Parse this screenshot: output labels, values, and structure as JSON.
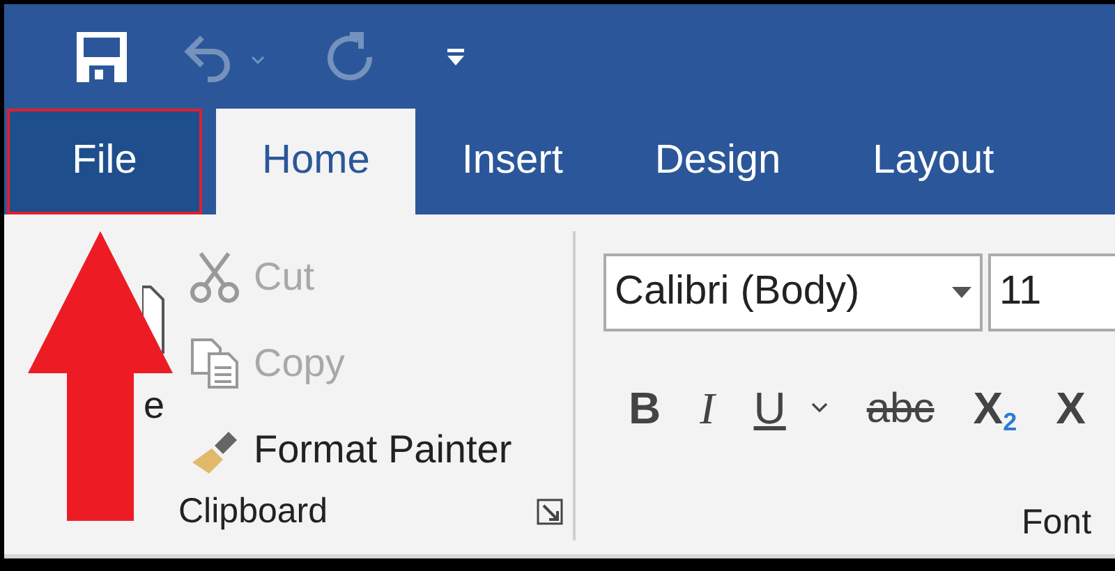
{
  "quick_access": [
    {
      "kind": "save",
      "disabled": false
    },
    {
      "kind": "undo",
      "disabled": true
    },
    {
      "kind": "redo",
      "disabled": true
    },
    {
      "kind": "customize",
      "disabled": false
    }
  ],
  "tabs": [
    {
      "label": "File",
      "kind": "backstage",
      "selected": false,
      "highlighted": true
    },
    {
      "label": "Home",
      "kind": "tab",
      "selected": true,
      "highlighted": false
    },
    {
      "label": "Insert",
      "kind": "tab",
      "selected": false,
      "highlighted": false
    },
    {
      "label": "Design",
      "kind": "tab",
      "selected": false,
      "highlighted": false
    },
    {
      "label": "Layout",
      "kind": "tab",
      "selected": false,
      "highlighted": false
    }
  ],
  "clipboard": {
    "paste": {
      "label": "e"
    },
    "items": [
      {
        "kind": "cut",
        "label": "Cut",
        "disabled": true
      },
      {
        "kind": "copy",
        "label": "Copy",
        "disabled": true
      },
      {
        "kind": "format_painter",
        "label": "Format Painter",
        "disabled": false
      }
    ],
    "group_label": "Clipboard"
  },
  "font": {
    "font_name": "Calibri (Body)",
    "font_size": "11",
    "buttons": [
      {
        "kind": "bold",
        "label": "B"
      },
      {
        "kind": "italic",
        "label": "I"
      },
      {
        "kind": "underline",
        "label": "U"
      },
      {
        "kind": "menu"
      },
      {
        "kind": "strikethrough",
        "label": "abc"
      },
      {
        "kind": "subscript",
        "label": "X$_{2}$"
      },
      {
        "kind": "superscript",
        "label": "X"
      }
    ],
    "group_label": "Font"
  },
  "annotations": [
    {
      "kind": "arrow"
    }
  ]
}
